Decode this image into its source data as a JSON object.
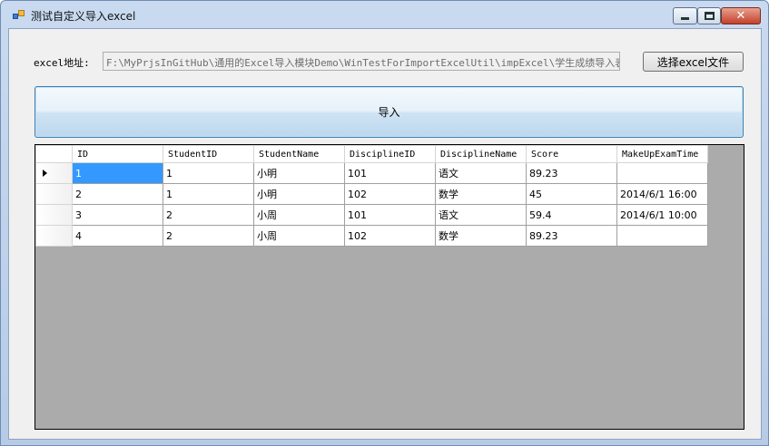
{
  "window": {
    "title": "测试自定义导入excel"
  },
  "form": {
    "path_label": "excel地址:",
    "path_value": "F:\\MyPrjsInGitHub\\通用的Excel导入模块Demo\\WinTestForImportExcelUtil\\impExcel\\学生成绩导入表.xl",
    "browse_label": "选择excel文件",
    "import_label": "导入"
  },
  "grid": {
    "columns": [
      "ID",
      "StudentID",
      "StudentName",
      "DisciplineID",
      "DisciplineName",
      "Score",
      "MakeUpExamTime"
    ],
    "rows": [
      [
        "1",
        "1",
        "小明",
        "101",
        "语文",
        "89.23",
        ""
      ],
      [
        "2",
        "1",
        "小明",
        "102",
        "数学",
        "45",
        "2014/6/1 16:00"
      ],
      [
        "3",
        "2",
        "小周",
        "101",
        "语文",
        "59.4",
        "2014/6/1 10:00"
      ],
      [
        "4",
        "2",
        "小周",
        "102",
        "数学",
        "89.23",
        ""
      ]
    ]
  },
  "colors": {
    "selection": "#3399ff",
    "grid_background": "#ababab",
    "button_border": "#3c7fb1"
  },
  "icons": {
    "app": "form-app-icon",
    "row_pointer": "current-row-arrow-icon"
  }
}
